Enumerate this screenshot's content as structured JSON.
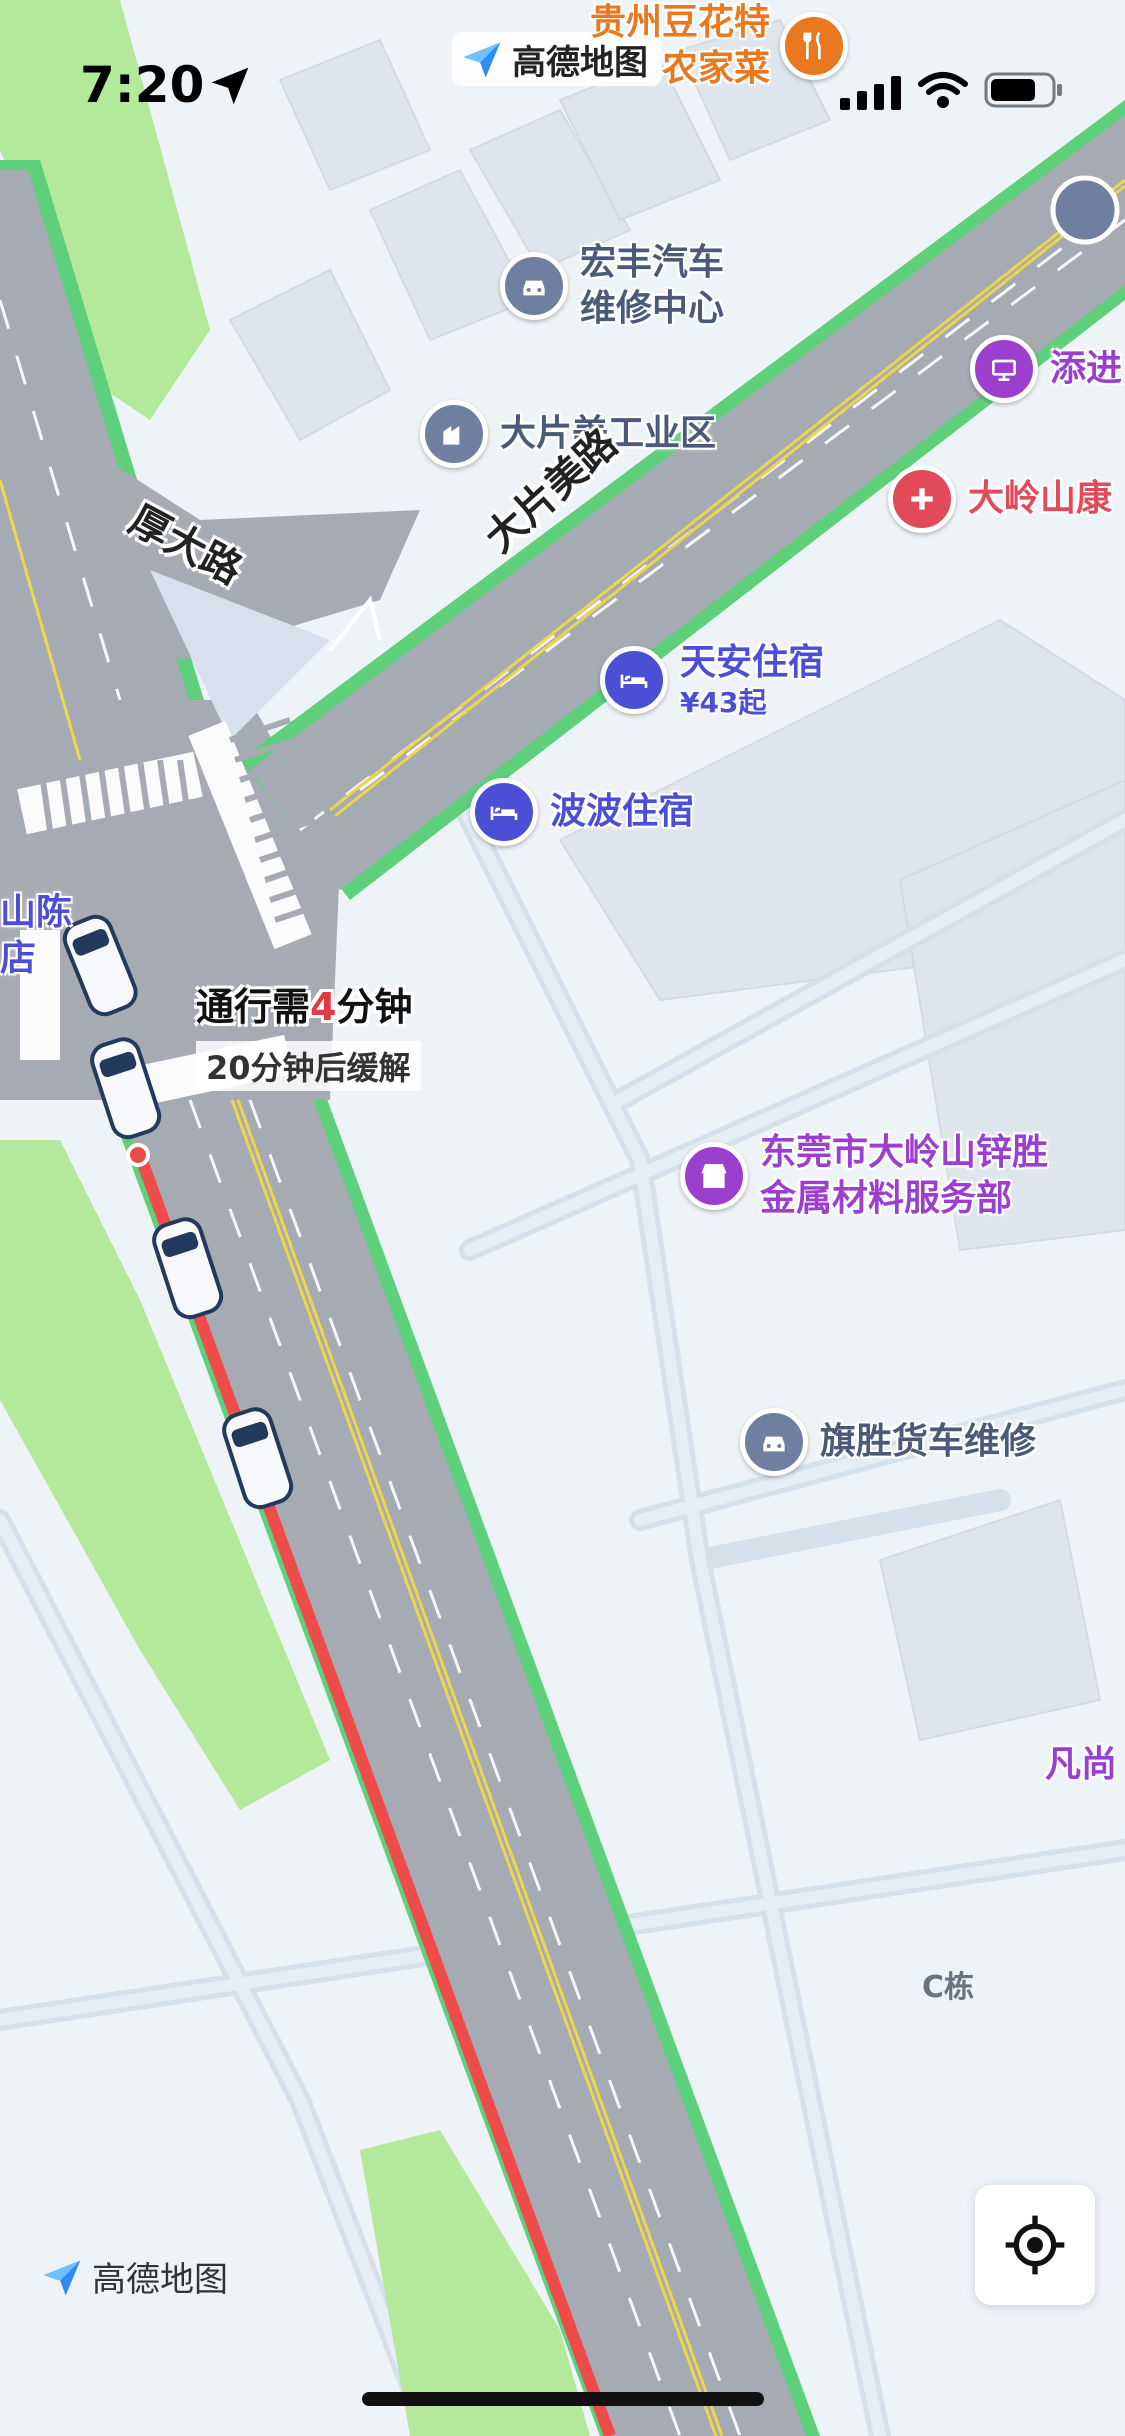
{
  "status_bar": {
    "time": "7:20"
  },
  "brand": {
    "name": "高德地图"
  },
  "colors": {
    "road": "#a6aab2",
    "road_edge": "#5ecf7a",
    "congestion": "#ef4b4b",
    "park": "#b4e89a",
    "background": "#eef3f8",
    "poi_purple": "#9b3fcf",
    "poi_blue": "#4b4fd6",
    "poi_red": "#e24a5a",
    "poi_orange": "#e9781f",
    "poi_gray": "#6e7fa0"
  },
  "roads": {
    "dapianmei": "大片美路",
    "houda": "厚大路"
  },
  "traffic": {
    "prefix": "通行需",
    "minutes": "4",
    "suffix": "分钟",
    "relief_minutes": "20",
    "relief_text": "分钟后缓解"
  },
  "pois": {
    "guizhou_line1": "贵州豆花特",
    "guizhou_line2": "农家菜",
    "hongfeng_line1": "宏丰汽车",
    "hongfeng_line2": "维修中心",
    "dapianmei_industrial": "大片美工业区",
    "tianjin": "添进",
    "daling_health": "大岭山康",
    "tianan": "天安住宿",
    "tianan_price": "¥43起",
    "bobo": "波波住宿",
    "shan_chen_line1": "山陈",
    "shan_chen_line2": "店",
    "zisheng_line1": "东莞市大岭山锌胜",
    "zisheng_line2": "金属材料服务部",
    "qisheng": "旗胜货车维修",
    "fanshang": "凡尚"
  },
  "building_labels": {
    "c_dong": "C栋"
  },
  "icons": {
    "location_arrow": "location-arrow-icon",
    "signal": "cellular-signal-icon",
    "wifi": "wifi-icon",
    "battery": "battery-icon",
    "car_repair": "car-icon",
    "hotel": "bed-icon",
    "hospital": "medical-cross-icon",
    "restaurant": "fork-knife-icon",
    "industrial": "factory-icon",
    "shop": "shop-icon",
    "locate": "locate-crosshair-icon"
  }
}
